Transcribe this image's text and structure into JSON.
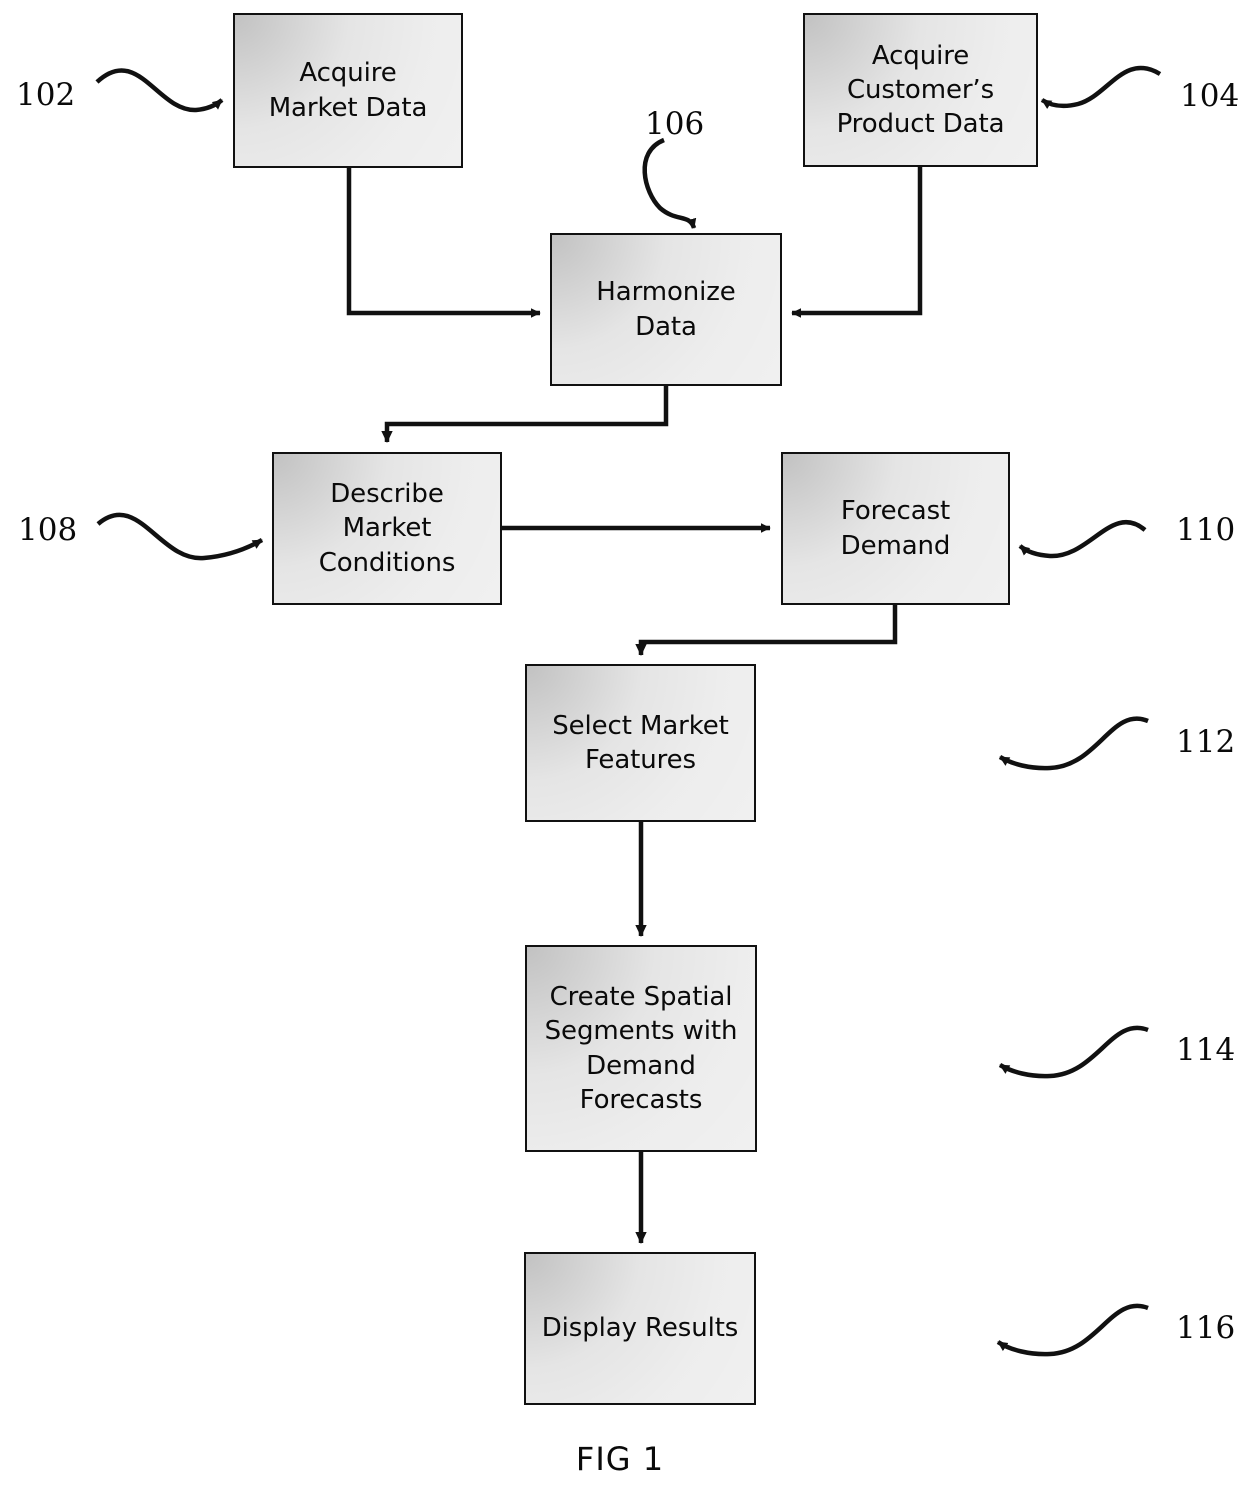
{
  "figure": {
    "caption": "FIG 1",
    "background_color": "#ffffff",
    "box_fill_color": "#f2f2f2",
    "line_color": "#111111"
  },
  "nodes": [
    {
      "id": "acquire-market-data",
      "label": "Acquire\nMarket Data",
      "ref": "102"
    },
    {
      "id": "acquire-customer-data",
      "label": "Acquire\nCustomer’s\nProduct Data",
      "ref": "104"
    },
    {
      "id": "harmonize-data",
      "label": "Harmonize\nData",
      "ref": "106"
    },
    {
      "id": "describe-market",
      "label": "Describe\nMarket\nConditions",
      "ref": "108"
    },
    {
      "id": "forecast-demand",
      "label": "Forecast\nDemand",
      "ref": "110"
    },
    {
      "id": "select-market-features",
      "label": "Select Market\nFeatures",
      "ref": "112"
    },
    {
      "id": "create-spatial",
      "label": "Create Spatial\nSegments with\nDemand\nForecasts",
      "ref": "114"
    },
    {
      "id": "display-results",
      "label": "Display Results",
      "ref": "116"
    }
  ],
  "ref_labels": {
    "r102": "102",
    "r104": "104",
    "r106": "106",
    "r108": "108",
    "r110": "110",
    "r112": "112",
    "r114": "114",
    "r116": "116"
  },
  "edges": [
    {
      "from": "acquire-market-data",
      "to": "harmonize-data",
      "style": "elbow-right-into-left"
    },
    {
      "from": "acquire-customer-data",
      "to": "harmonize-data",
      "style": "elbow-left-into-right"
    },
    {
      "from": "harmonize-data",
      "to": "describe-market",
      "style": "elbow-down-left"
    },
    {
      "from": "describe-market",
      "to": "forecast-demand",
      "style": "straight-right"
    },
    {
      "from": "forecast-demand",
      "to": "select-market-features",
      "style": "elbow-down-left"
    },
    {
      "from": "select-market-features",
      "to": "create-spatial",
      "style": "straight-down"
    },
    {
      "from": "create-spatial",
      "to": "display-results",
      "style": "straight-down"
    }
  ]
}
